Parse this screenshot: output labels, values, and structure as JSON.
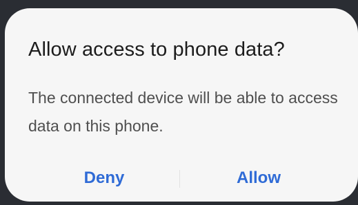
{
  "dialog": {
    "title": "Allow access to phone data?",
    "message": "The connected device will be able to access data on this phone.",
    "buttons": {
      "deny_label": "Deny",
      "allow_label": "Allow"
    }
  },
  "colors": {
    "background": "#f6f6f6",
    "accent": "#2f6bd6",
    "title_text": "#1c1c1c",
    "body_text": "#4f4f4f"
  }
}
